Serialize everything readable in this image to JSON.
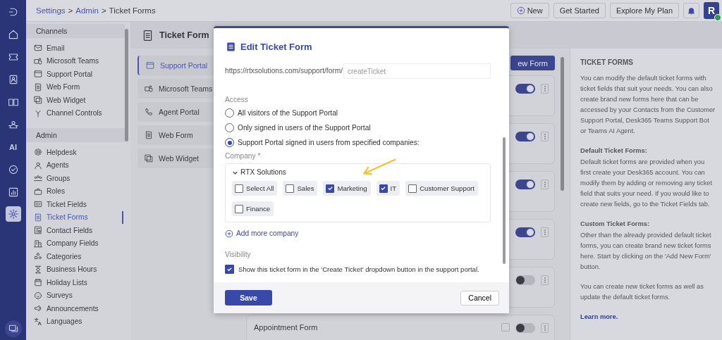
{
  "rail": [
    {
      "selected": false
    },
    {
      "selected": false
    },
    {
      "selected": false
    },
    {
      "selected": false
    },
    {
      "selected": false
    },
    {
      "selected": false
    },
    {
      "label": "AI",
      "selected": false
    },
    {
      "selected": false
    },
    {
      "selected": false
    },
    {
      "selected": true
    }
  ],
  "breadcrumb": {
    "separator": ">",
    "items": [
      {
        "label": "Settings",
        "link": true
      },
      {
        "label": "Admin",
        "link": true
      },
      {
        "label": "Ticket Forms",
        "link": false
      }
    ]
  },
  "top_actions": [
    {
      "label": "New",
      "kind": "new"
    },
    {
      "label": "Get Started",
      "kind": "plain"
    },
    {
      "label": "Explore My Plan",
      "kind": "plain"
    }
  ],
  "avatar": {
    "initial": "R",
    "online": true
  },
  "sidebar": [
    {
      "title": "Channels",
      "items": [
        {
          "label": "Email",
          "selected": false
        },
        {
          "label": "Microsoft Teams",
          "selected": false
        },
        {
          "label": "Support Portal",
          "selected": false
        },
        {
          "label": "Web Form",
          "selected": false
        },
        {
          "label": "Web Widget",
          "selected": false
        },
        {
          "label": "Channel Controls",
          "selected": false
        }
      ]
    },
    {
      "title": "Admin",
      "items": [
        {
          "label": "Helpdesk",
          "selected": false
        },
        {
          "label": "Agents",
          "selected": false
        },
        {
          "label": "Groups",
          "selected": false
        },
        {
          "label": "Roles",
          "selected": false
        },
        {
          "label": "Ticket Fields",
          "selected": false
        },
        {
          "label": "Ticket Forms",
          "selected": true
        },
        {
          "label": "Contact Fields",
          "selected": false
        },
        {
          "label": "Company Fields",
          "selected": false
        },
        {
          "label": "Categories",
          "selected": false
        },
        {
          "label": "Business Hours",
          "selected": false
        },
        {
          "label": "Holiday Lists",
          "selected": false
        },
        {
          "label": "Surveys",
          "selected": false
        },
        {
          "label": "Announcements",
          "selected": false
        },
        {
          "label": "Languages",
          "selected": false
        }
      ]
    }
  ],
  "page_title": "Ticket Form",
  "channel_tabs": [
    {
      "label": "Support Portal",
      "selected": true
    },
    {
      "label": "Microsoft Teams",
      "selected": false
    },
    {
      "label": "Agent Portal",
      "selected": false
    },
    {
      "label": "Web Form",
      "selected": false
    },
    {
      "label": "Web Widget",
      "selected": false
    }
  ],
  "new_form_button": "ew Form",
  "forms": [
    {
      "on": true
    },
    {
      "on": true
    },
    {
      "on": true
    },
    {
      "on": true
    },
    {
      "on": false
    },
    {
      "title": "Appointment Form",
      "on": false
    }
  ],
  "help": {
    "title": "TICKET FORMS",
    "blocks": [
      {
        "text": "You can modify the default ticket forms with ticket fields that suit your needs. You can also create brand new forms here that can be accessed by your Contacts from the Customer Support Portal, Desk365 Teams Support Bot or Teams AI Agent."
      },
      {
        "heading": "Default Ticket Forms:",
        "text": "Default ticket forms are provided when you first create your Desk365 account. You can modify them by adding or removing any ticket field that suits your need. If you would like to create new fields, go to the Ticket Fields tab."
      },
      {
        "heading": "Custom Ticket Forms:",
        "text": "Other than the already provided default ticket forms, you can create brand new ticket forms here. Start by clicking on the 'Add New Form' button."
      },
      {
        "text": "You can create new ticket forms as well as update the default ticket forms."
      }
    ],
    "link": "Learn more."
  },
  "modal": {
    "title": "Edit Ticket Form",
    "url_prefix": "https://rtxsolutions.com/support/form/",
    "slug_placeholder": "createTicket",
    "access_label": "Access",
    "access_options": [
      {
        "label": "All visitors of the Support Portal",
        "selected": false
      },
      {
        "label": "Only signed in users of the Support Portal",
        "selected": false
      },
      {
        "label": "Support Portal signed in users from specified companies:",
        "selected": true
      }
    ],
    "company_label": "Company *",
    "company": {
      "name": "RTX Solutions",
      "expanded": true,
      "departments": [
        {
          "label": "Select All",
          "checked": false
        },
        {
          "label": "Sales",
          "checked": false
        },
        {
          "label": "Marketing",
          "checked": true
        },
        {
          "label": "IT",
          "checked": true
        },
        {
          "label": "Customer Support",
          "checked": false
        },
        {
          "label": "Finance",
          "checked": false
        }
      ]
    },
    "add_company": "Add more company",
    "visibility_label": "Visibility",
    "visibility_option": {
      "label": "Show this ticket form in the 'Create Ticket' dropdown button in the support portal.",
      "checked": true
    },
    "save": "Save",
    "cancel": "Cancel"
  }
}
